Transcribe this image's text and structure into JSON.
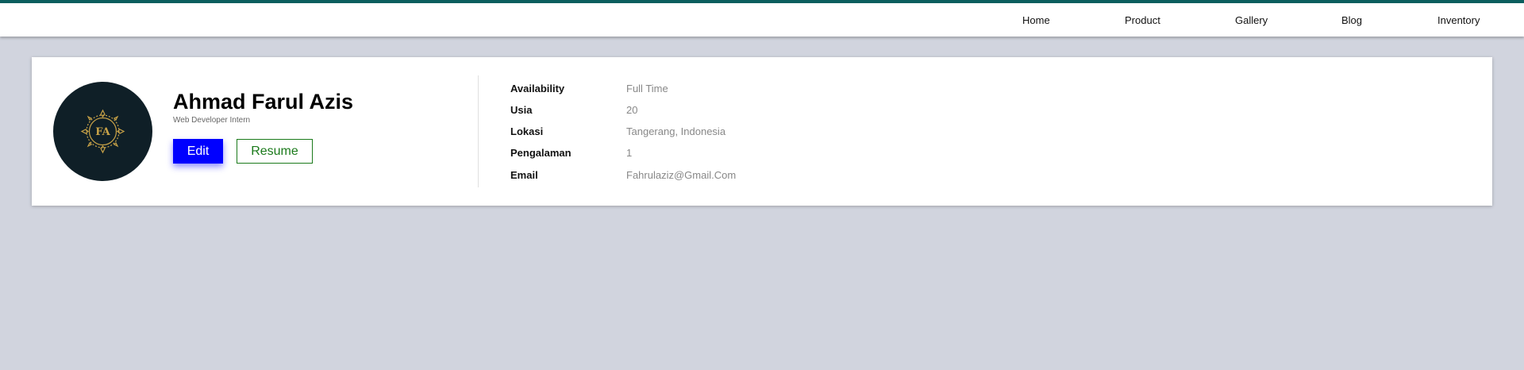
{
  "nav": {
    "items": [
      "Home",
      "Product",
      "Gallery",
      "Blog",
      "Inventory"
    ]
  },
  "profile": {
    "avatar_initials": "FA",
    "name": "Ahmad Farul Azis",
    "role": "Web Developer Intern",
    "edit_label": "Edit",
    "resume_label": "Resume"
  },
  "details": [
    {
      "label": "Availability",
      "value": "Full Time"
    },
    {
      "label": "Usia",
      "value": "20"
    },
    {
      "label": "Lokasi",
      "value": "Tangerang, Indonesia"
    },
    {
      "label": "Pengalaman",
      "value": "1"
    },
    {
      "label": "Email",
      "value": "Fahrulaziz@Gmail.Com"
    }
  ],
  "colors": {
    "accent_bar": "#0b5e5e",
    "edit_button": "#0000ff",
    "resume_border": "#1b7a1b",
    "avatar_bg": "#0f1f27",
    "avatar_gold": "#c9a348",
    "page_bg": "#d1d4de"
  }
}
